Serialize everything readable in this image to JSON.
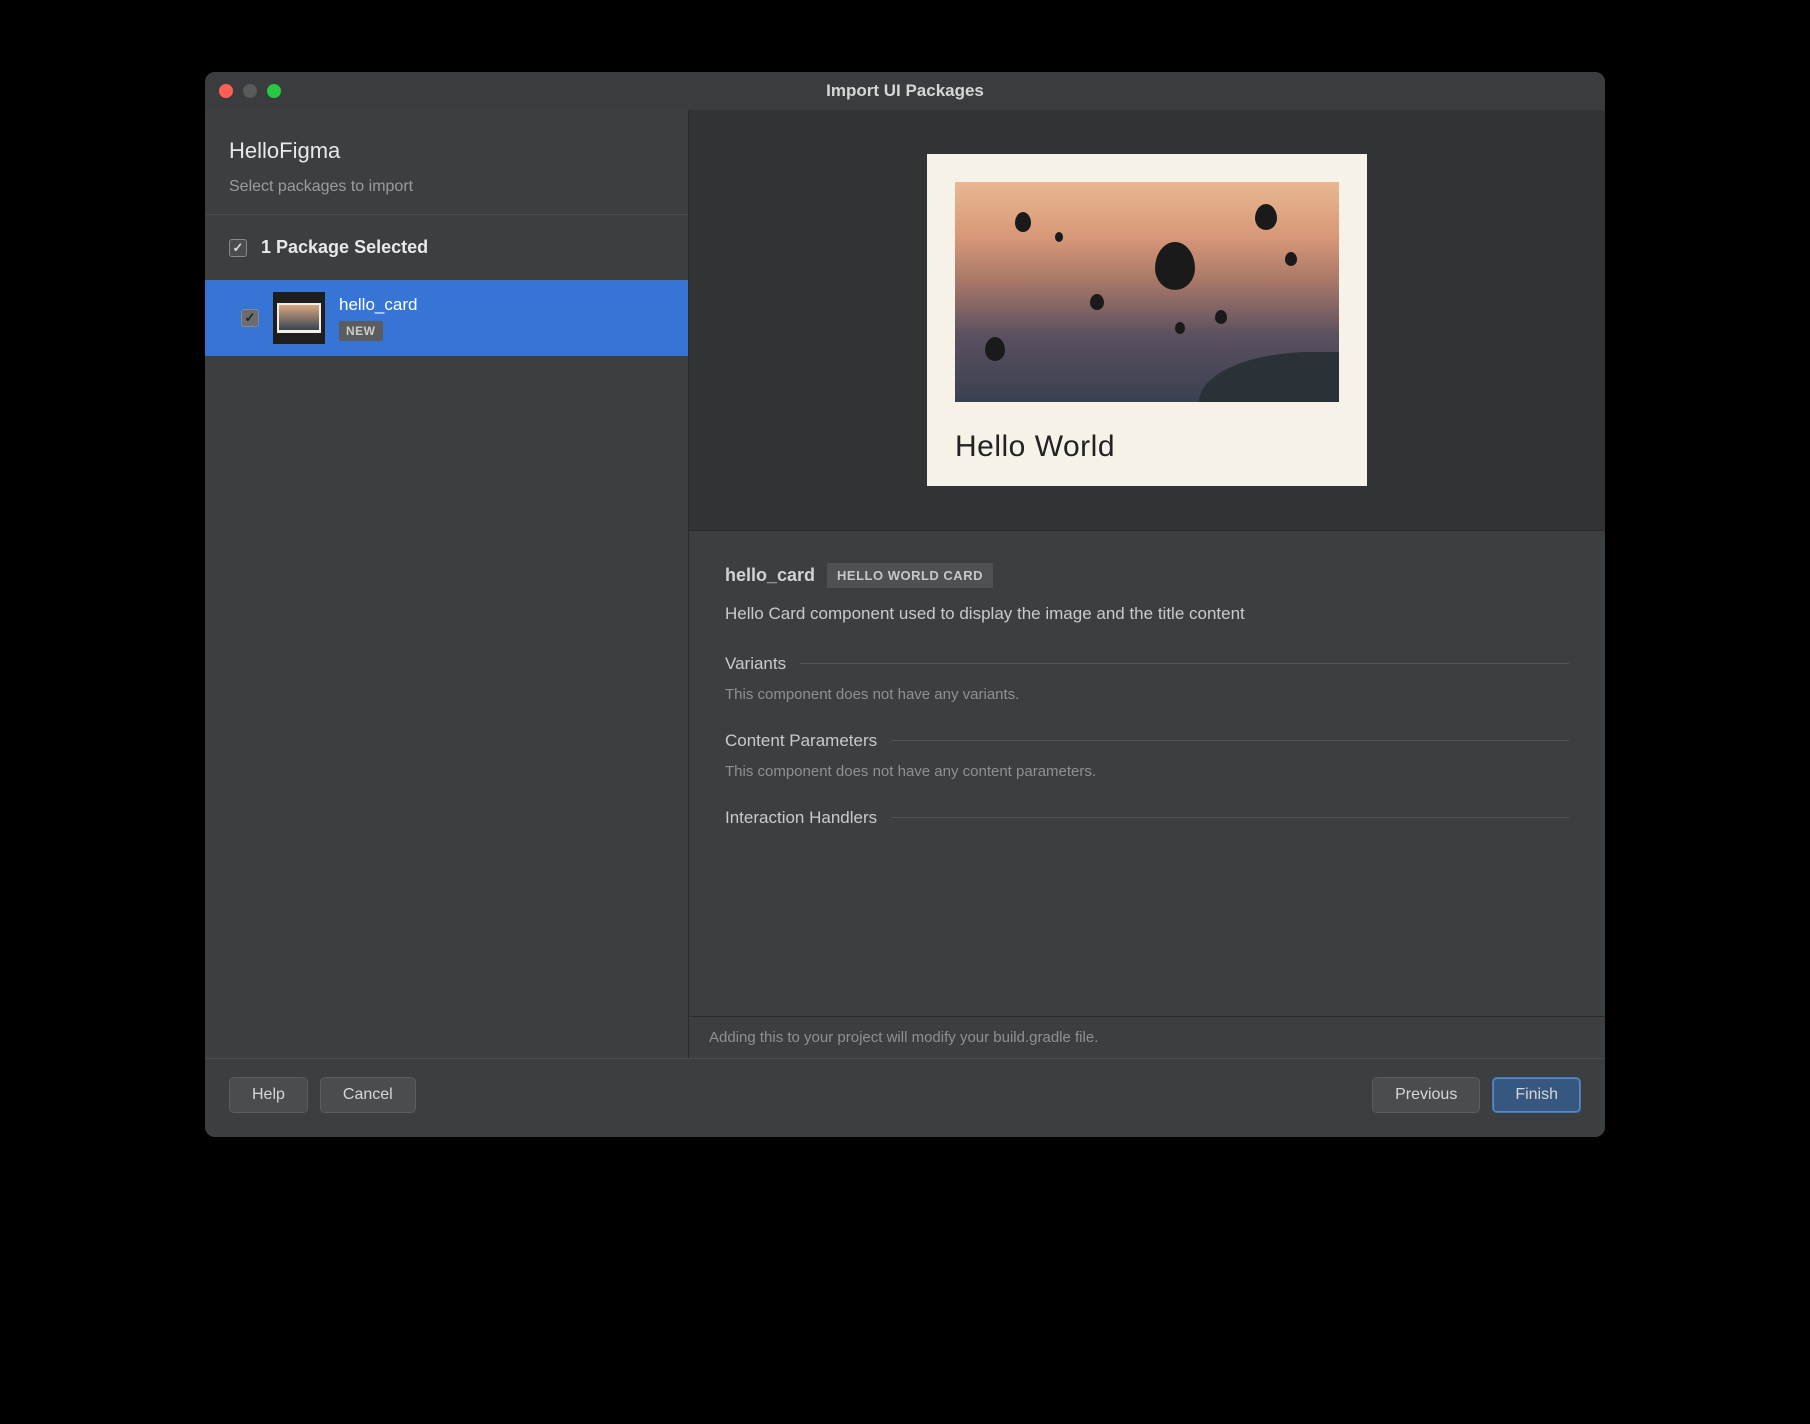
{
  "window": {
    "title": "Import UI Packages"
  },
  "sidebar": {
    "project": "HelloFigma",
    "subtitle": "Select packages to import",
    "selected_count_label": "1 Package Selected",
    "packages": [
      {
        "name": "hello_card",
        "badge": "NEW",
        "checked": true,
        "selected": true
      }
    ]
  },
  "preview": {
    "card_title": "Hello World"
  },
  "details": {
    "name": "hello_card",
    "badge": "HELLO WORLD CARD",
    "description": "Hello Card component used to display the image and the title content",
    "sections": {
      "variants": {
        "title": "Variants",
        "body": "This component does not have any variants."
      },
      "content_parameters": {
        "title": "Content Parameters",
        "body": "This component does not have any content parameters."
      },
      "interaction_handlers": {
        "title": "Interaction Handlers"
      }
    }
  },
  "footer_note": "Adding this to your project will modify your build.gradle file.",
  "buttons": {
    "help": "Help",
    "cancel": "Cancel",
    "previous": "Previous",
    "finish": "Finish"
  }
}
